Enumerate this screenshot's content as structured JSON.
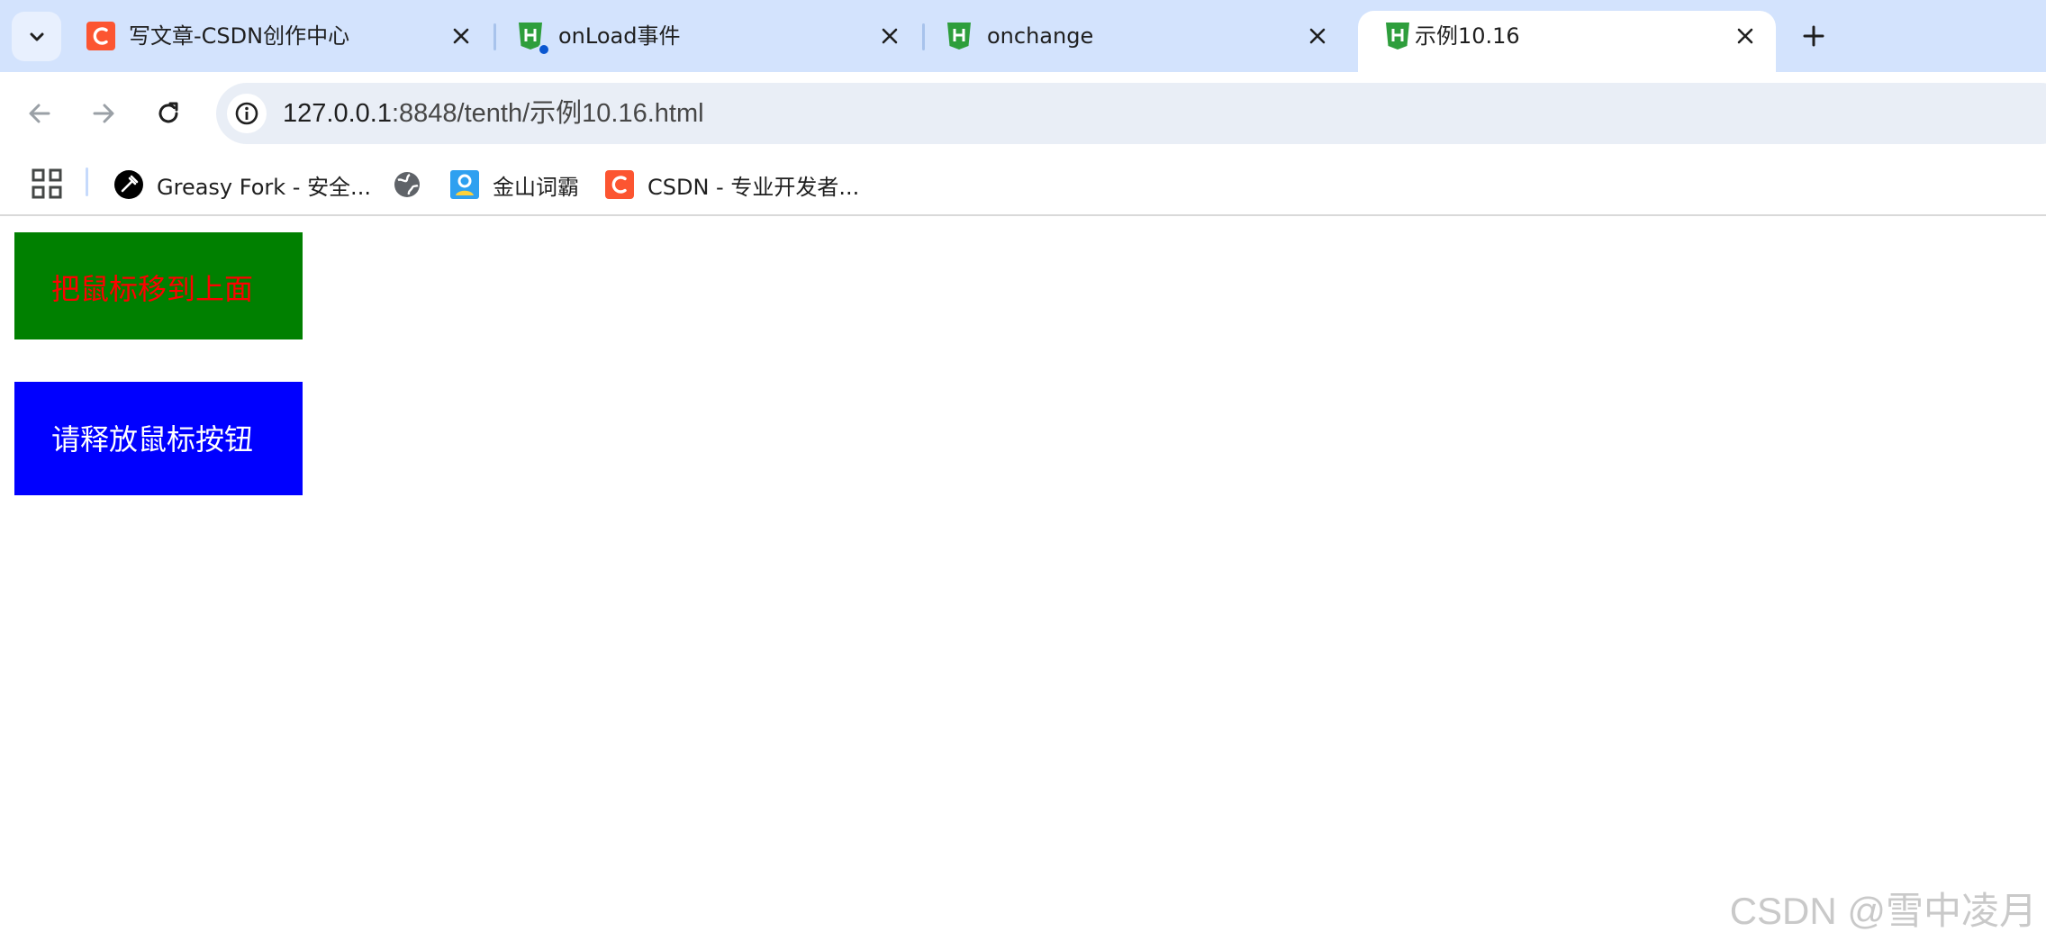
{
  "browser": {
    "tabs": [
      {
        "title": "写文章-CSDN创作中心",
        "favicon": "csdn-icon",
        "active": false
      },
      {
        "title": "onLoad事件",
        "favicon": "html5-icon",
        "active": false,
        "indicator": true
      },
      {
        "title": "onchange",
        "favicon": "html5-icon",
        "active": false
      },
      {
        "title": "示例10.16",
        "favicon": "html5-icon",
        "active": true
      }
    ],
    "address_bar": {
      "host": "127.0.0.1",
      "rest": ":8848/tenth/示例10.16.html"
    },
    "bookmarks": [
      {
        "label": "Greasy Fork - 安全...",
        "icon": "greasy-fork-icon"
      },
      {
        "label": "",
        "icon": "globe-icon"
      },
      {
        "label": "金山词霸",
        "icon": "kingsoft-ciba-icon"
      },
      {
        "label": "CSDN - 专业开发者...",
        "icon": "csdn-icon"
      }
    ]
  },
  "page": {
    "green_box_text": "把鼠标移到上面",
    "blue_box_text": "请释放鼠标按钮",
    "watermark": "CSDN @雪中凌月"
  },
  "colors": {
    "tab_strip": "#d3e3fd",
    "green_box_bg": "#008000",
    "green_box_text": "#ff0000",
    "blue_box_bg": "#0000ff",
    "blue_box_text": "#ffffff",
    "csdn_brand": "#fc5531",
    "html5_favicon": "#2e9e3c"
  }
}
